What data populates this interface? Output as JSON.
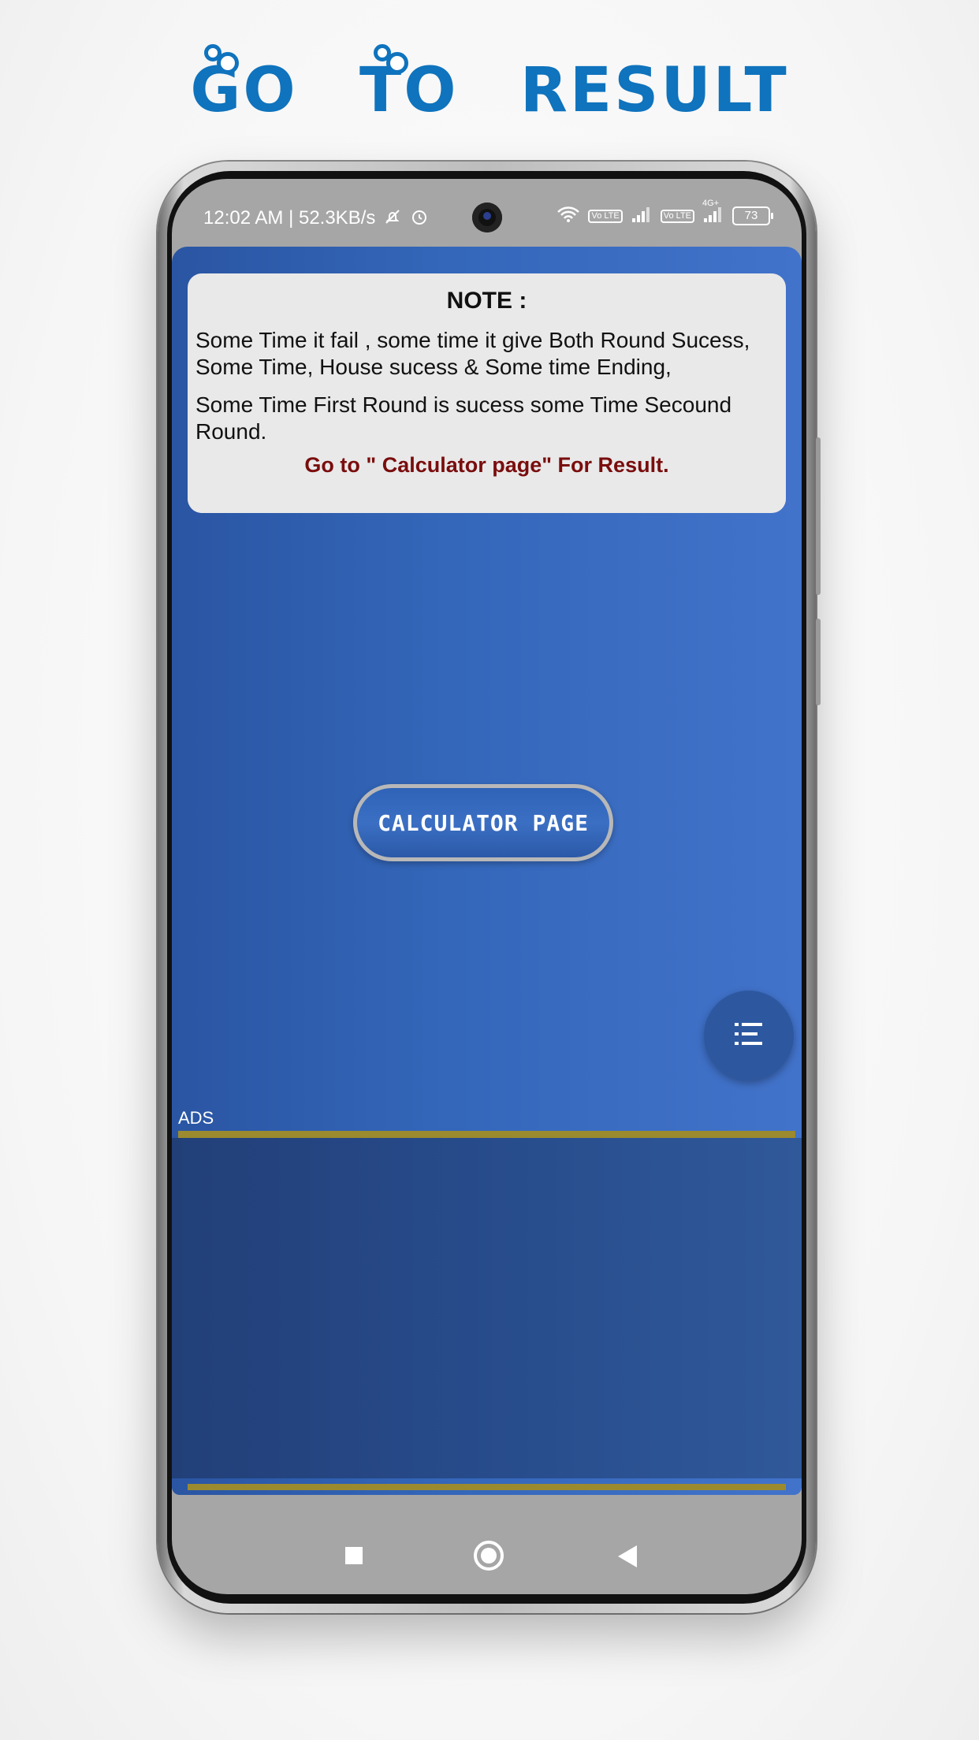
{
  "headline": {
    "part1": "GO",
    "part2": "TO",
    "part3": "RESULT",
    "color": "#0f73bd"
  },
  "status_bar": {
    "time_speed": "12:02 AM | 52.3KB/s",
    "icons": [
      "notifications-off-icon",
      "alarm-icon",
      "wifi-icon",
      "volte-icon",
      "signal-icon",
      "volte-icon",
      "signal-4g-icon",
      "battery-icon"
    ],
    "lte_label": "Vo LTE",
    "network_label": "4G+",
    "battery": "73"
  },
  "note": {
    "title": "NOTE :",
    "paragraph1": "Some Time it fail , some time it give Both Round Sucess, Some Time, House sucess & Some time Ending,",
    "paragraph2": "Some Time First Round is sucess some Time Secound Round.",
    "link_text": "Go to \" Calculator page\"  For Result.",
    "link_color": "#7a0d0d"
  },
  "calculator_button": {
    "label": "CALCULATOR PAGE"
  },
  "fab": {
    "icon": "list-menu-icon"
  },
  "ads": {
    "label": "ADS",
    "divider_color": "#9b8a2e"
  },
  "nav_bar": {
    "icons": [
      "recents-square-icon",
      "home-circle-icon",
      "back-triangle-icon"
    ]
  },
  "colors": {
    "screen_bg": "#3467ba",
    "note_bg": "#e9e9e9"
  }
}
